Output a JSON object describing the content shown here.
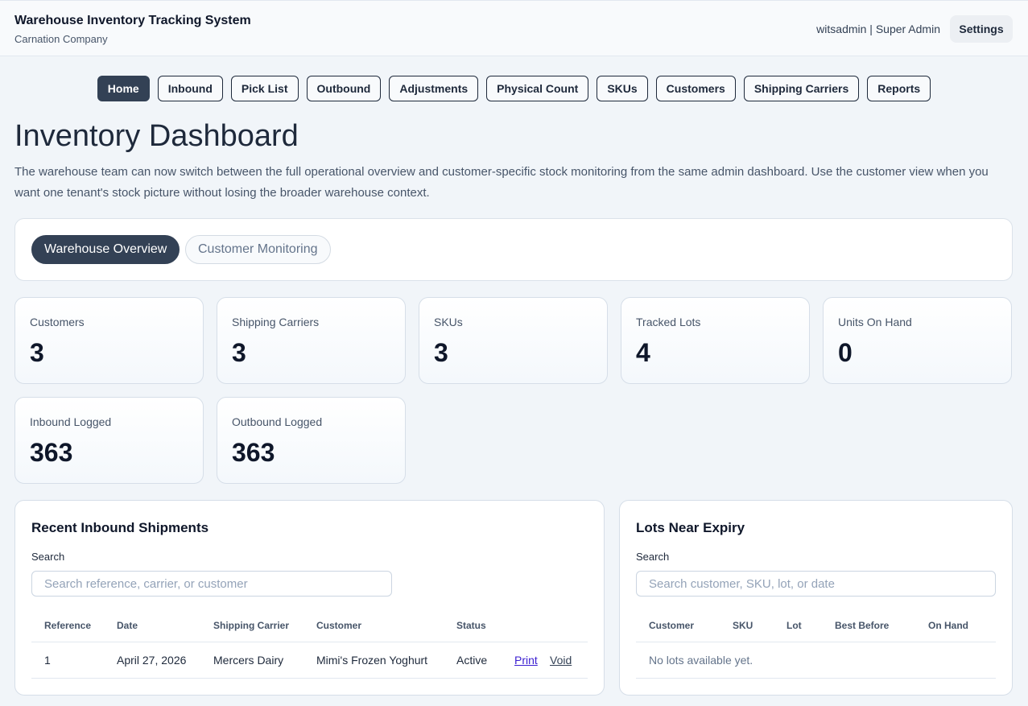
{
  "header": {
    "app_title": "Warehouse Inventory Tracking System",
    "company": "Carnation Company",
    "user_info": "witsadmin | Super Admin",
    "settings_label": "Settings"
  },
  "nav": {
    "home": "Home",
    "inbound": "Inbound",
    "pick_list": "Pick List",
    "outbound": "Outbound",
    "adjustments": "Adjustments",
    "physical_count": "Physical Count",
    "skus": "SKUs",
    "customers": "Customers",
    "shipping_carriers": "Shipping Carriers",
    "reports": "Reports",
    "active": "Home"
  },
  "page": {
    "title": "Inventory Dashboard",
    "description": "The warehouse team can now switch between the full operational overview and customer-specific stock monitoring from the same admin dashboard. Use the customer view when you want one tenant's stock picture without losing the broader warehouse context."
  },
  "view_toggle": {
    "overview": "Warehouse Overview",
    "monitoring": "Customer Monitoring",
    "selected": "Warehouse Overview"
  },
  "stats": {
    "customers": {
      "label": "Customers",
      "value": "3"
    },
    "carriers": {
      "label": "Shipping Carriers",
      "value": "3"
    },
    "skus": {
      "label": "SKUs",
      "value": "3"
    },
    "lots": {
      "label": "Tracked Lots",
      "value": "4"
    },
    "units": {
      "label": "Units On Hand",
      "value": "0"
    },
    "inbound": {
      "label": "Inbound Logged",
      "value": "363"
    },
    "outbound": {
      "label": "Outbound Logged",
      "value": "363"
    }
  },
  "inbound_panel": {
    "title": "Recent Inbound Shipments",
    "search_label": "Search",
    "search_placeholder": "Search reference, carrier, or customer",
    "columns": {
      "reference": "Reference",
      "date": "Date",
      "carrier": "Shipping Carrier",
      "customer": "Customer",
      "status": "Status"
    },
    "rows": [
      {
        "reference": "1",
        "date": "April 27, 2026",
        "carrier": "Mercers Dairy",
        "customer": "Mimi's Frozen Yoghurt",
        "status": "Active",
        "print": "Print",
        "void": "Void"
      }
    ]
  },
  "expiry_panel": {
    "title": "Lots Near Expiry",
    "search_label": "Search",
    "search_placeholder": "Search customer, SKU, lot, or date",
    "columns": {
      "customer": "Customer",
      "sku": "SKU",
      "lot": "Lot",
      "best_before": "Best Before",
      "on_hand": "On Hand"
    },
    "empty_message": "No lots available yet."
  },
  "colors": {
    "accent_dark": "#334155",
    "page_bg": "#f1f5f9",
    "link": "#3b1fd1"
  }
}
